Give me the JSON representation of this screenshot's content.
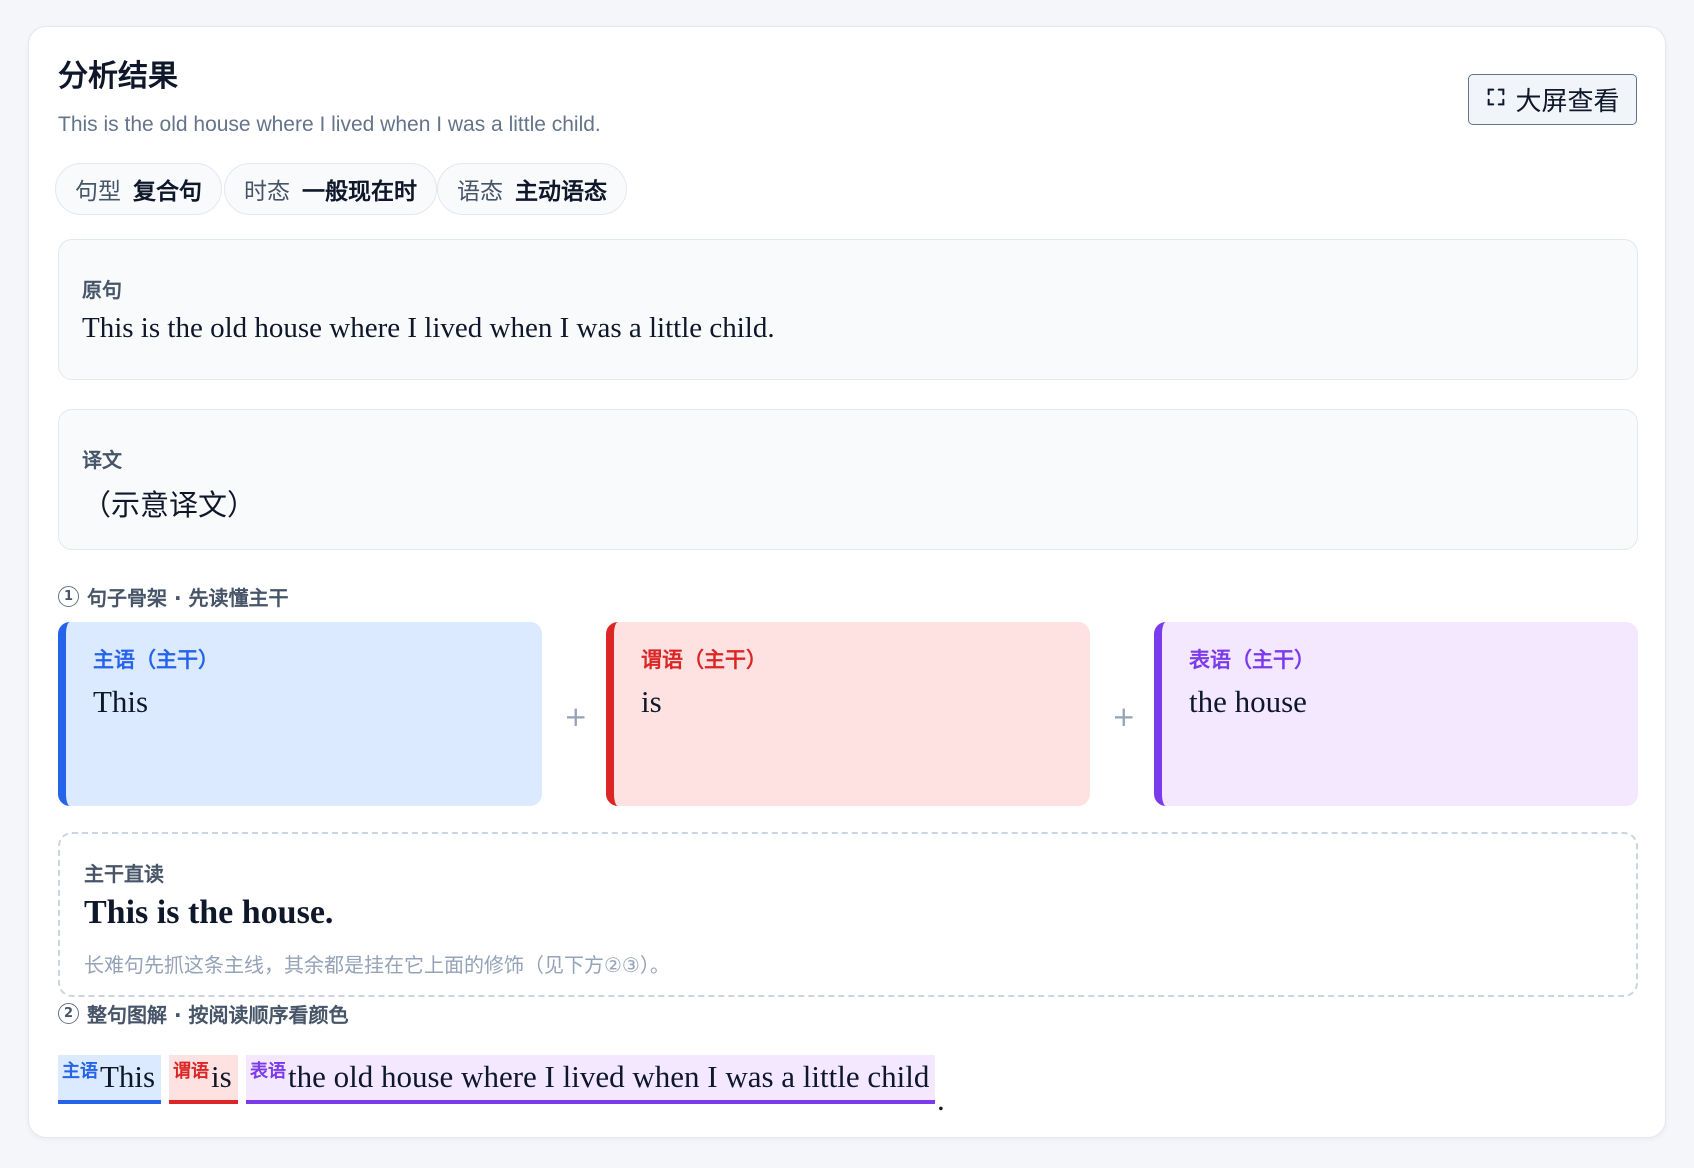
{
  "header": {
    "title": "分析结果",
    "subtitle": "This is the old house where I lived when I was a little child.",
    "fullscreen_label": "大屏查看"
  },
  "tags": [
    {
      "key": "句型",
      "value": "复合句"
    },
    {
      "key": "时态",
      "value": "一般现在时"
    },
    {
      "key": "语态",
      "value": "主动语态"
    }
  ],
  "original": {
    "label": "原句",
    "text": "This is the old house where I lived when I was a little child."
  },
  "translation": {
    "label": "译文",
    "text": "（示意译文）"
  },
  "skeleton": {
    "number": "1",
    "title": "句子骨架 · 先读懂主干",
    "parts": [
      {
        "label": "主语（主干）",
        "text": "This",
        "color": "#2563eb",
        "bg": "#dbeafe"
      },
      {
        "label": "谓语（主干）",
        "text": "is",
        "color": "#dc2626",
        "bg": "#fee2e2"
      },
      {
        "label": "表语（主干）",
        "text": "the house",
        "color": "#7c3aed",
        "bg": "#f3e8ff"
      }
    ],
    "plus": "+"
  },
  "direct_read": {
    "label": "主干直读",
    "text": "This is the house.",
    "note": "长难句先抓这条主线，其余都是挂在它上面的修饰（见下方②③）。"
  },
  "diagram": {
    "number": "2",
    "title": "整句图解 · 按阅读顺序看颜色",
    "segments": [
      {
        "label": "主语",
        "text": "This",
        "color": "#2563eb",
        "bg": "#dbeafe"
      },
      {
        "label": "谓语",
        "text": "is",
        "color": "#dc2626",
        "bg": "#fee2e2"
      },
      {
        "label": "表语",
        "text": "the old house where I lived when I was a little child",
        "color": "#7c3aed",
        "bg": "#f3e8ff"
      }
    ],
    "trailing": "."
  }
}
